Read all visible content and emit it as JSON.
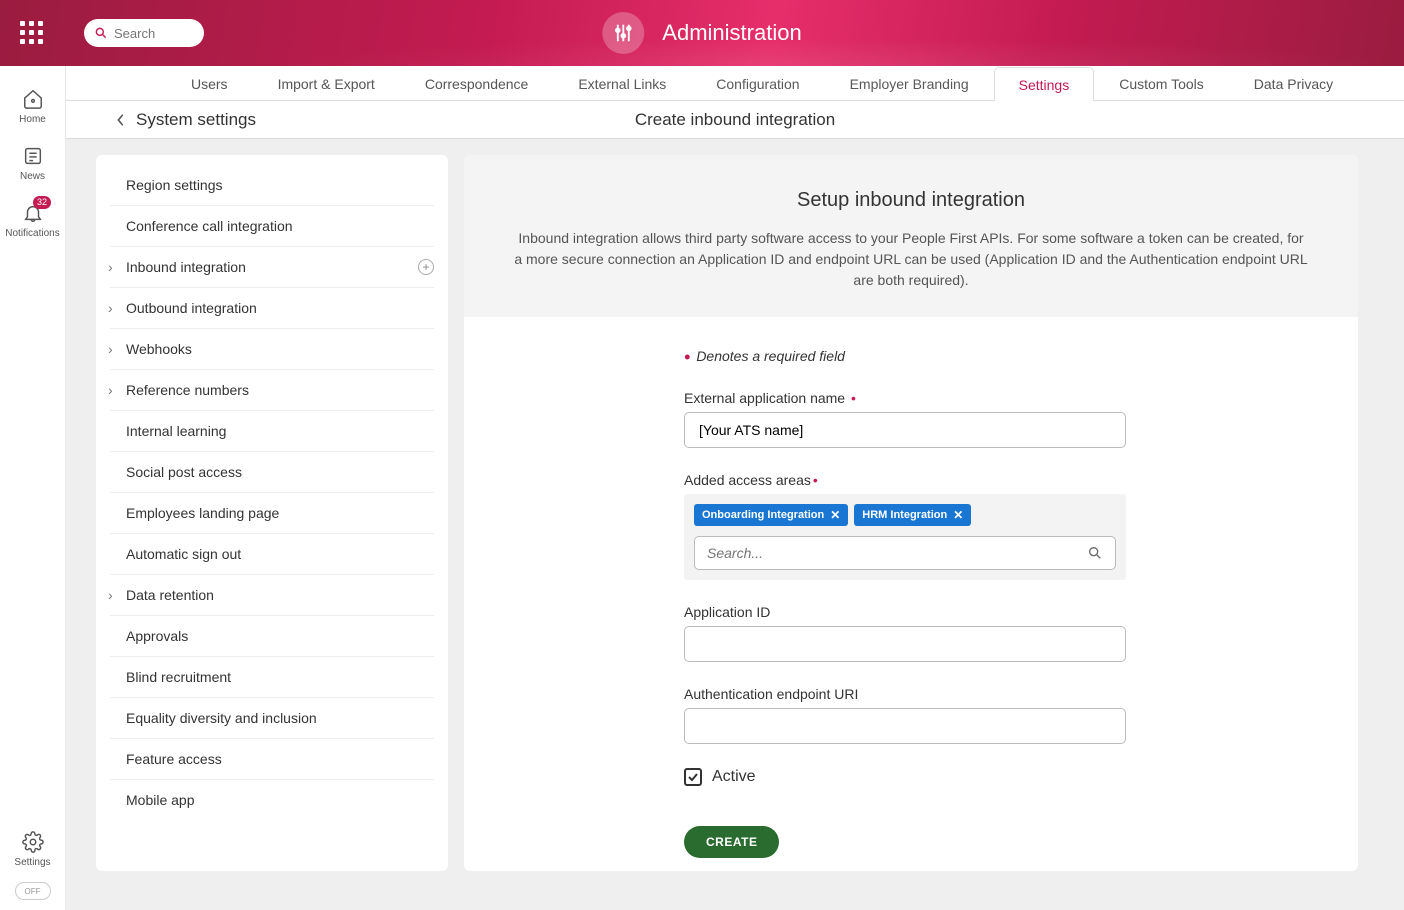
{
  "header": {
    "title": "Administration",
    "search_placeholder": "Search"
  },
  "leftnav": {
    "home": "Home",
    "news": "News",
    "notifications": "Notifications",
    "notif_count": "32",
    "settings": "Settings",
    "toggle": "OFF"
  },
  "tabs": [
    {
      "label": "Users"
    },
    {
      "label": "Import & Export"
    },
    {
      "label": "Correspondence"
    },
    {
      "label": "External Links"
    },
    {
      "label": "Configuration"
    },
    {
      "label": "Employer Branding"
    },
    {
      "label": "Settings",
      "active": true
    },
    {
      "label": "Custom Tools"
    },
    {
      "label": "Data Privacy"
    }
  ],
  "subhead": {
    "back_label": "System settings",
    "page_title": "Create inbound integration"
  },
  "sidebar": {
    "items": [
      {
        "label": "Region settings"
      },
      {
        "label": "Conference call integration"
      },
      {
        "label": "Inbound integration",
        "chev": true,
        "plus": true
      },
      {
        "label": "Outbound integration",
        "chev": true
      },
      {
        "label": "Webhooks",
        "chev": true
      },
      {
        "label": "Reference numbers",
        "chev": true
      },
      {
        "label": "Internal learning"
      },
      {
        "label": "Social post access"
      },
      {
        "label": "Employees landing page"
      },
      {
        "label": "Automatic sign out"
      },
      {
        "label": "Data retention",
        "chev": true
      },
      {
        "label": "Approvals"
      },
      {
        "label": "Blind recruitment"
      },
      {
        "label": "Equality diversity and inclusion"
      },
      {
        "label": "Feature access"
      },
      {
        "label": "Mobile app"
      }
    ]
  },
  "form": {
    "hero_title": "Setup inbound integration",
    "hero_desc": "Inbound integration allows third party software access to your People First APIs. For some software a token can be created, for a more secure connection an Application ID and endpoint URL can be used (Application ID and the Authentication endpoint URL are both required).",
    "required_note": "Denotes a required field",
    "ext_app_label": "External application name",
    "ext_app_value": "[Your ATS name]",
    "access_label": "Added access areas",
    "access_tags": [
      "Onboarding Integration",
      "HRM Integration"
    ],
    "access_search_placeholder": "Search...",
    "app_id_label": "Application ID",
    "app_id_value": "",
    "auth_uri_label": "Authentication endpoint URI",
    "auth_uri_value": "",
    "active_label": "Active",
    "active_checked": true,
    "create_label": "CREATE"
  }
}
